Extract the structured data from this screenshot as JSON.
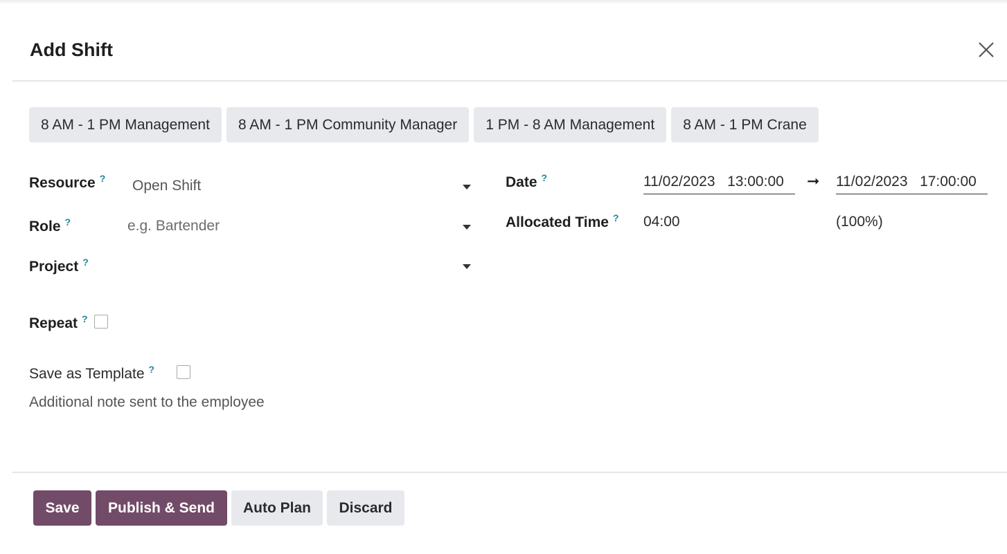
{
  "dialog": {
    "title": "Add Shift"
  },
  "templates": [
    {
      "label": "8 AM - 1 PM Management"
    },
    {
      "label": "8 AM - 1 PM Community Manager"
    },
    {
      "label": "1 PM - 8 AM Management"
    },
    {
      "label": "8 AM - 1 PM Crane"
    }
  ],
  "form": {
    "help_mark": "?",
    "resource": {
      "label": "Resource",
      "value": "Open Shift"
    },
    "role": {
      "label": "Role",
      "placeholder": "e.g. Bartender"
    },
    "project": {
      "label": "Project",
      "value": ""
    },
    "date": {
      "label": "Date",
      "start_date": "11/02/2023",
      "start_time": "13:00:00",
      "end_date": "11/02/2023",
      "end_time": "17:00:00",
      "arrow": "➞"
    },
    "allocated_time": {
      "label": "Allocated Time",
      "value": "04:00",
      "percent": "(100%)"
    },
    "repeat": {
      "label": "Repeat",
      "checked": false
    },
    "save_as_template": {
      "label": "Save as Template",
      "checked": false
    },
    "note": "Additional note sent to the employee"
  },
  "footer": {
    "save_label": "Save",
    "publish_label": "Publish & Send",
    "auto_plan_label": "Auto Plan",
    "discard_label": "Discard"
  },
  "colors": {
    "primary": "#714b67",
    "secondary_bg": "#e8e9ed",
    "help": "#1a87a0"
  }
}
